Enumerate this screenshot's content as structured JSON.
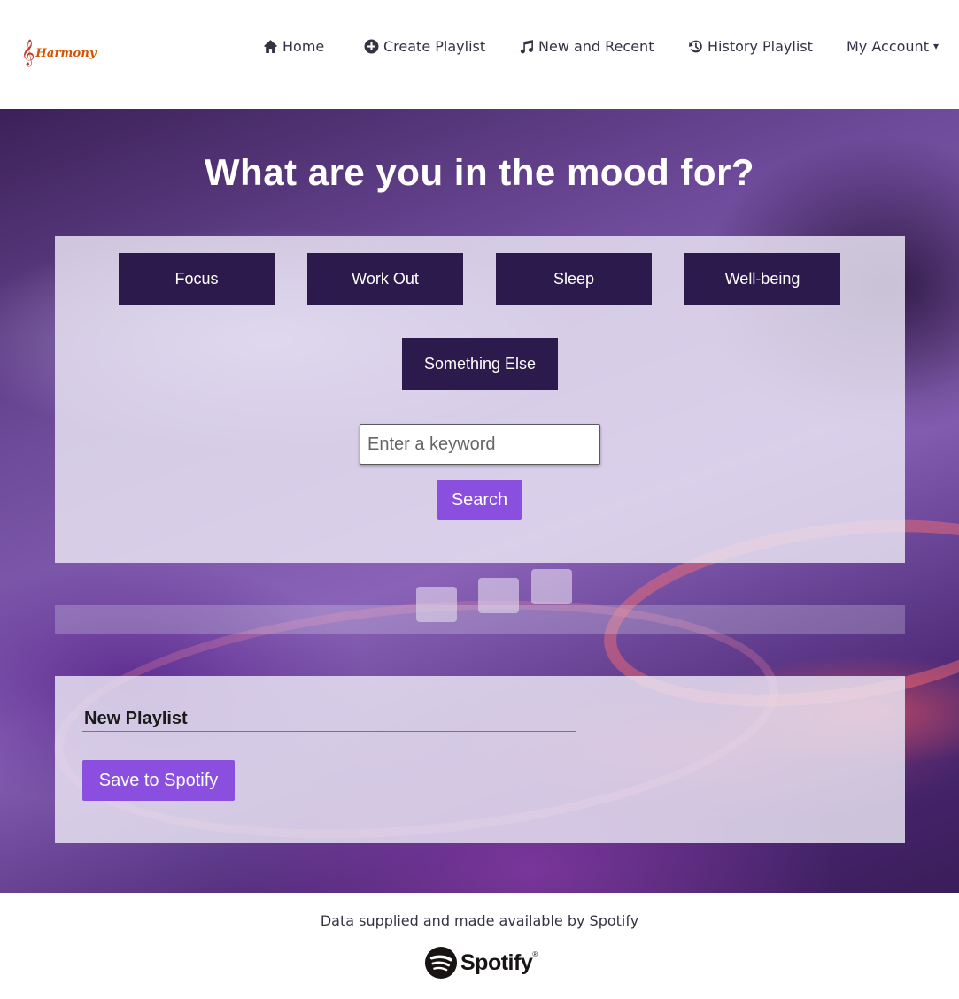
{
  "brand": {
    "name": "Harmony",
    "clef_glyph": "𝄞",
    "color": "#d35400"
  },
  "nav": {
    "home": {
      "label": "Home",
      "icon": "home-icon"
    },
    "create": {
      "label": "Create Playlist",
      "icon": "plus-circle-icon"
    },
    "new_recent": {
      "label": "New and Recent",
      "icon": "music-icon"
    },
    "history": {
      "label": "History Playlist",
      "icon": "history-icon"
    },
    "account": {
      "label": "My Account",
      "caret": "▾",
      "icon": "caret-down-icon"
    }
  },
  "hero": {
    "title": "What are you in the mood for?"
  },
  "moods": {
    "focus": "Focus",
    "workout": "Work Out",
    "sleep": "Sleep",
    "wellbeing": "Well-being",
    "something_else": "Something Else"
  },
  "search": {
    "placeholder": "Enter a keyword",
    "value": "",
    "button": "Search"
  },
  "playlist": {
    "name": "New Playlist",
    "save_button": "Save to Spotify"
  },
  "footer": {
    "credit": "Data supplied and made available by Spotify",
    "logo_text": "Spotify",
    "registered": "®"
  },
  "colors": {
    "mood_button_bg": "#2d1a4c",
    "accent": "#8b4fe0",
    "panel_bg": "#ebe8f5"
  }
}
